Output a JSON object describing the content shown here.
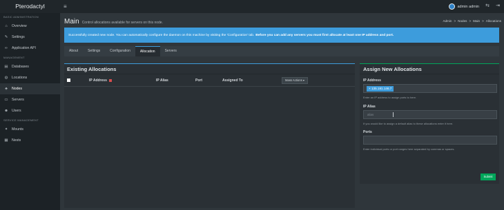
{
  "app": {
    "brand": "Pterodactyl",
    "username": "admin admin"
  },
  "sidebar": {
    "sections": [
      {
        "title": "BASIC ADMINISTRATION",
        "items": [
          {
            "label": "Overview",
            "icon": "home-icon"
          },
          {
            "label": "Settings",
            "icon": "wrench-icon"
          },
          {
            "label": "Application API",
            "icon": "link-icon"
          }
        ]
      },
      {
        "title": "MANAGEMENT",
        "items": [
          {
            "label": "Databases",
            "icon": "database-icon"
          },
          {
            "label": "Locations",
            "icon": "globe-icon"
          },
          {
            "label": "Nodes",
            "icon": "sitemap-icon",
            "active": true
          },
          {
            "label": "Servers",
            "icon": "server-icon"
          },
          {
            "label": "Users",
            "icon": "users-icon"
          }
        ]
      },
      {
        "title": "SERVICE MANAGEMENT",
        "items": [
          {
            "label": "Mounts",
            "icon": "magic-icon"
          },
          {
            "label": "Nests",
            "icon": "th-large-icon"
          }
        ]
      }
    ]
  },
  "header": {
    "title": "Main",
    "subtitle": "Control allocations available for servers on this node."
  },
  "breadcrumb": [
    "Admin",
    ">",
    "Nodes",
    ">",
    "Main",
    ">",
    "Allocations"
  ],
  "alert": {
    "text": "Successfully created new node. You can automatically configure the daemon on this machine by visiting the 'Configuration' tab.",
    "bold": "Before you can add any servers you must first allocate at least one IP address and port."
  },
  "tabs": [
    "About",
    "Settings",
    "Configuration",
    "Allocation",
    "Servers"
  ],
  "existing": {
    "title": "Existing Allocations",
    "columns": [
      "IP Address",
      "IP Alias",
      "Port",
      "Assigned To"
    ],
    "more_actions": "Mass Actions ▾"
  },
  "assign": {
    "title": "Assign New Allocations",
    "ip_label": "IP Address",
    "ip_tag": "× 135.181.146.7",
    "ip_hint": "Enter an IP address to assign ports to here.",
    "alias_label": "IP Alias",
    "alias_placeholder": "alias",
    "alias_hint": "If you would like to assign a default alias to these allocations enter it here.",
    "ports_label": "Ports",
    "ports_hint": "Enter individual ports or port ranges here separated by commas or spaces.",
    "submit": "Submit"
  },
  "colors": {
    "accent": "#3d9cdc",
    "success": "#00a65a",
    "danger": "#d54e4e"
  }
}
